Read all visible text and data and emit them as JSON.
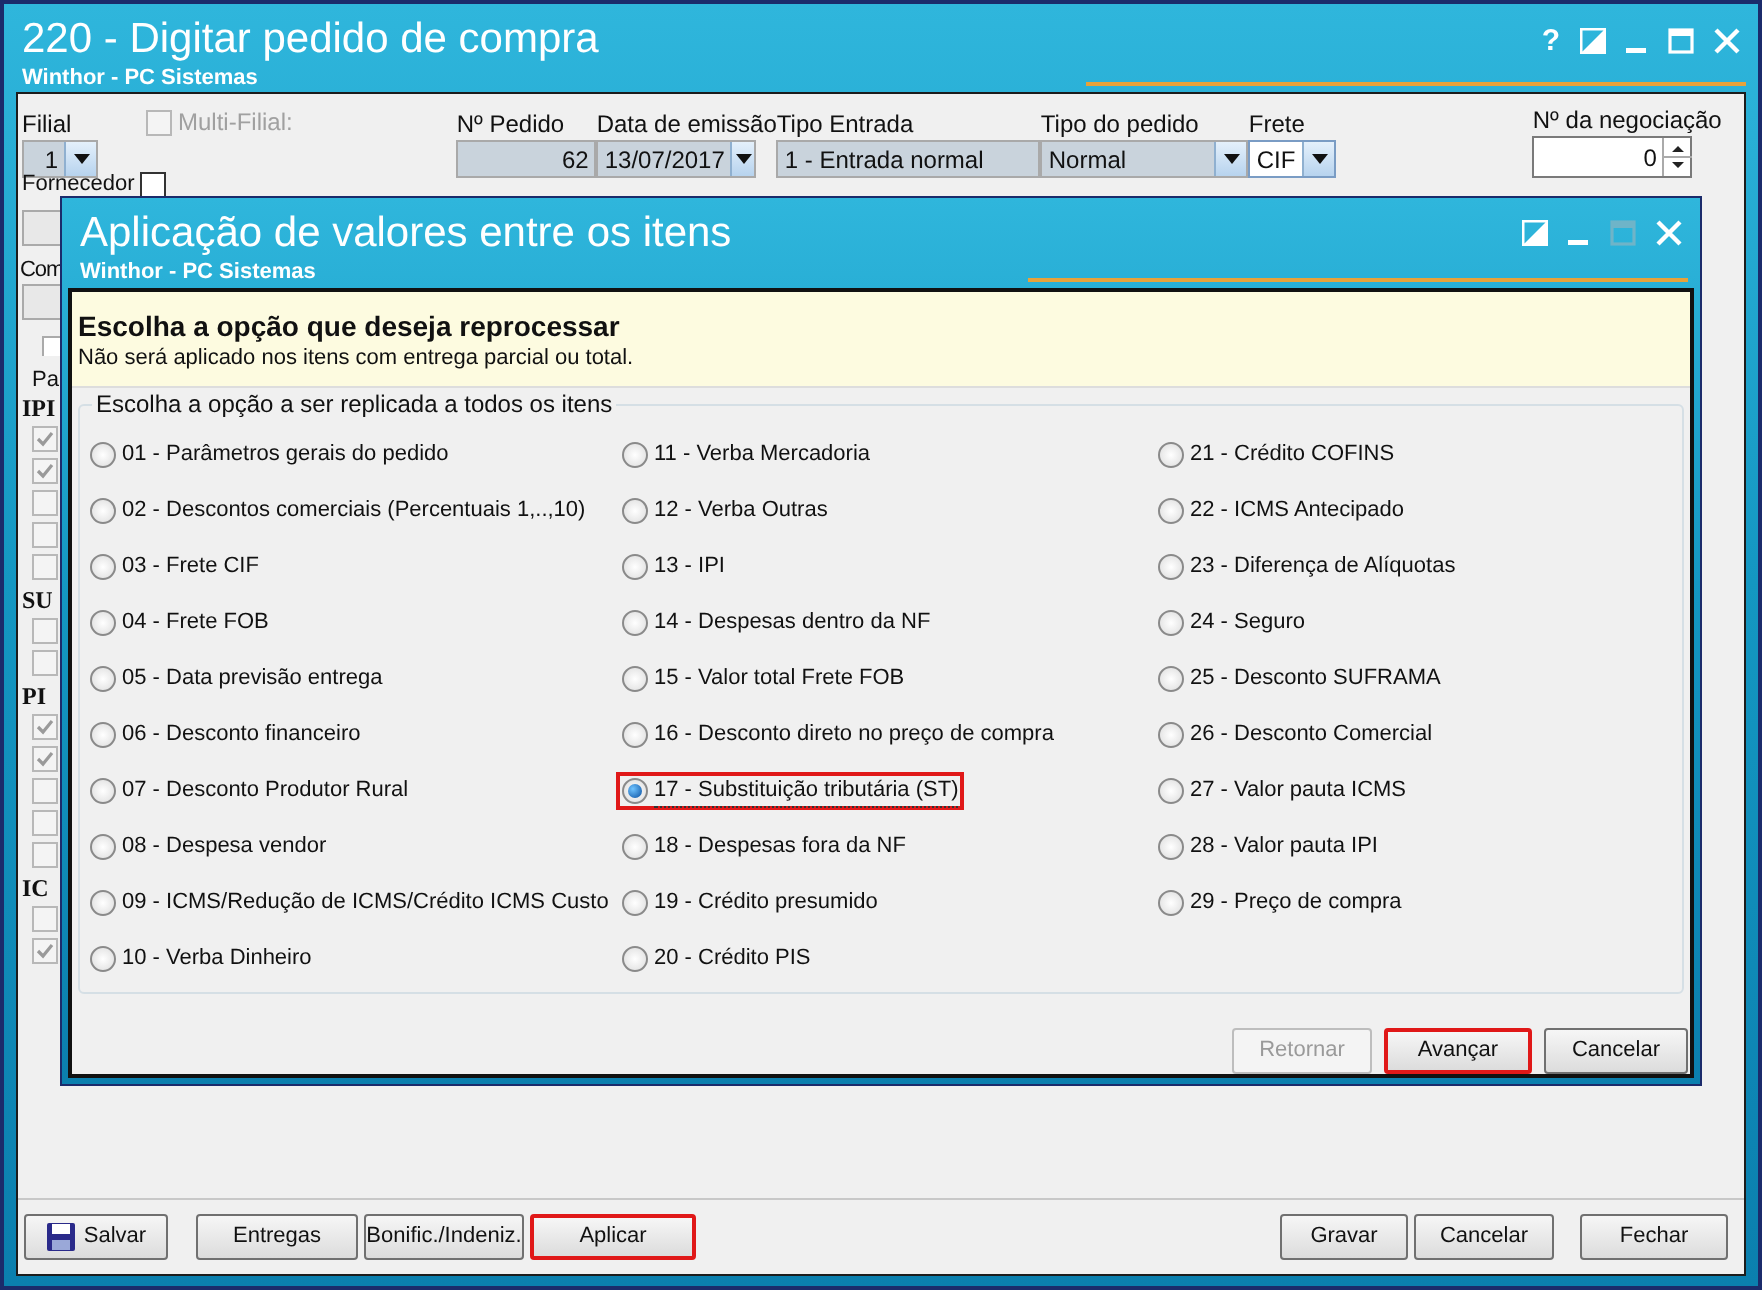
{
  "window": {
    "title": "220 - Digitar pedido de compra",
    "subtitle": "Winthor - PC Sistemas",
    "help": "?"
  },
  "fields": [
    {
      "label": "Filial",
      "value": "1",
      "kind": "combo"
    },
    {
      "label": "Nº Pedido",
      "value": "62",
      "kind": "readonly"
    },
    {
      "label": "Data de emissão",
      "value": "13/07/2017",
      "kind": "combo"
    },
    {
      "label": "Tipo Entrada",
      "value": "1 - Entrada normal",
      "kind": "readonly"
    },
    {
      "label": "Tipo do pedido",
      "value": "Normal",
      "kind": "combo"
    },
    {
      "label": "Frete",
      "value": "CIF",
      "kind": "combo"
    },
    {
      "label": "Nº da negociação",
      "value": "0",
      "kind": "spinner"
    }
  ],
  "multi_filial": {
    "label": "Multi-Filial:",
    "checked": false,
    "disabled": true
  },
  "fornecedor_label": "Fornecedor",
  "desbloqueados": {
    "checked": false
  },
  "com_label": "Com",
  "pa_label": "Pa",
  "groups": [
    {
      "label": "IPI",
      "checks": [
        true,
        true,
        false,
        false,
        false
      ]
    },
    {
      "label": "SU",
      "checks": [
        false,
        false
      ]
    },
    {
      "label": "PI",
      "checks": [
        true,
        true,
        false,
        false,
        false
      ]
    },
    {
      "label": "IC",
      "checks": [
        false,
        true
      ]
    }
  ],
  "dialog": {
    "title": "Aplicação de valores entre os itens",
    "subtitle": "Winthor - PC Sistemas",
    "heading": "Escolha a opção que deseja reprocessar",
    "note": "Não será aplicado nos itens com entrega parcial ou total.",
    "group_title": "Escolha a opção a ser replicada a todos os itens",
    "options": [
      {
        "label": "01 - Parâmetros gerais do pedido",
        "selected": false,
        "highlighted": false
      },
      {
        "label": "02 - Descontos comerciais (Percentuais 1,..,10)",
        "selected": false,
        "highlighted": false
      },
      {
        "label": "03 - Frete CIF",
        "selected": false,
        "highlighted": false
      },
      {
        "label": "04 - Frete FOB",
        "selected": false,
        "highlighted": false
      },
      {
        "label": "05 - Data previsão entrega",
        "selected": false,
        "highlighted": false
      },
      {
        "label": "06 - Desconto financeiro",
        "selected": false,
        "highlighted": false
      },
      {
        "label": "07 - Desconto Produtor Rural",
        "selected": false,
        "highlighted": false
      },
      {
        "label": "08 - Despesa vendor",
        "selected": false,
        "highlighted": false
      },
      {
        "label": "09 - ICMS/Redução de ICMS/Crédito ICMS Custo",
        "selected": false,
        "highlighted": false
      },
      {
        "label": "10 - Verba Dinheiro",
        "selected": false,
        "highlighted": false
      },
      {
        "label": "11 - Verba Mercadoria",
        "selected": false,
        "highlighted": false
      },
      {
        "label": "12 - Verba Outras",
        "selected": false,
        "highlighted": false
      },
      {
        "label": "13 - IPI",
        "selected": false,
        "highlighted": false
      },
      {
        "label": "14 - Despesas dentro da NF",
        "selected": false,
        "highlighted": false
      },
      {
        "label": "15 - Valor total Frete FOB",
        "selected": false,
        "highlighted": false
      },
      {
        "label": "16 - Desconto direto no preço de compra",
        "selected": false,
        "highlighted": false
      },
      {
        "label": "17 - Substituição tributária (ST)",
        "selected": true,
        "highlighted": true
      },
      {
        "label": "18 - Despesas fora da NF",
        "selected": false,
        "highlighted": false
      },
      {
        "label": "19 - Crédito presumido",
        "selected": false,
        "highlighted": false
      },
      {
        "label": "20 - Crédito PIS",
        "selected": false,
        "highlighted": false
      },
      {
        "label": "21 - Crédito COFINS",
        "selected": false,
        "highlighted": false
      },
      {
        "label": "22 - ICMS Antecipado",
        "selected": false,
        "highlighted": false
      },
      {
        "label": "23 - Diferença de Alíquotas",
        "selected": false,
        "highlighted": false
      },
      {
        "label": "24 - Seguro",
        "selected": false,
        "highlighted": false
      },
      {
        "label": "25 - Desconto SUFRAMA",
        "selected": false,
        "highlighted": false
      },
      {
        "label": "26 - Desconto Comercial",
        "selected": false,
        "highlighted": false
      },
      {
        "label": "27 - Valor pauta ICMS",
        "selected": false,
        "highlighted": false
      },
      {
        "label": "28 - Valor pauta IPI",
        "selected": false,
        "highlighted": false
      },
      {
        "label": "29 - Preço de compra",
        "selected": false,
        "highlighted": false
      }
    ],
    "buttons": [
      {
        "label": "Retornar",
        "disabled": true,
        "highlighted": false
      },
      {
        "label": "Avançar",
        "disabled": false,
        "highlighted": true
      },
      {
        "label": "Cancelar",
        "disabled": false,
        "highlighted": false
      }
    ]
  },
  "bottom_left": [
    {
      "label": "Salvar",
      "kind": "save",
      "highlighted": false
    },
    {
      "label": "Entregas",
      "kind": "plain",
      "highlighted": false
    },
    {
      "label": "Bonific./Indeniz.",
      "kind": "plain",
      "highlighted": false
    },
    {
      "label": "Aplicar",
      "kind": "plain",
      "highlighted": true
    }
  ],
  "bottom_right": [
    {
      "label": "Gravar",
      "highlighted": false
    },
    {
      "label": "Cancelar",
      "highlighted": false
    },
    {
      "label": "Fechar",
      "highlighted": false
    }
  ]
}
